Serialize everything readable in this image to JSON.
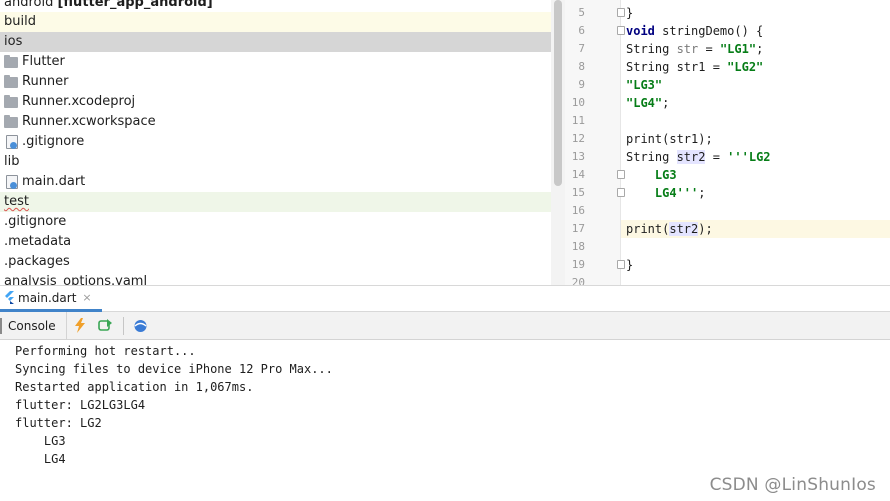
{
  "project_tree": {
    "rows": [
      {
        "indent": 4,
        "icon": "none",
        "label": "android",
        "suffix": "[flutter_app_android]",
        "highlight": "none"
      },
      {
        "indent": 4,
        "icon": "none",
        "label": "build",
        "suffix": "",
        "highlight": "yellow"
      },
      {
        "indent": 4,
        "icon": "none",
        "label": "ios",
        "suffix": "",
        "highlight": "selected"
      },
      {
        "indent": 4,
        "icon": "folder-icon",
        "label": "Flutter",
        "suffix": "",
        "highlight": "none"
      },
      {
        "indent": 4,
        "icon": "folder-icon",
        "label": "Runner",
        "suffix": "",
        "highlight": "none"
      },
      {
        "indent": 4,
        "icon": "folder-icon",
        "label": "Runner.xcodeproj",
        "suffix": "",
        "highlight": "none"
      },
      {
        "indent": 4,
        "icon": "folder-icon",
        "label": "Runner.xcworkspace",
        "suffix": "",
        "highlight": "none"
      },
      {
        "indent": 4,
        "icon": "file-icon",
        "label": ".gitignore",
        "suffix": "",
        "highlight": "none"
      },
      {
        "indent": 4,
        "icon": "none",
        "label": "lib",
        "suffix": "",
        "highlight": "none"
      },
      {
        "indent": 4,
        "icon": "file-icon",
        "label": "main.dart",
        "suffix": "",
        "highlight": "none"
      },
      {
        "indent": 4,
        "icon": "none",
        "label": "test",
        "suffix": "",
        "highlight": "green"
      },
      {
        "indent": 4,
        "icon": "none",
        "label": ".gitignore",
        "suffix": "",
        "highlight": "none"
      },
      {
        "indent": 4,
        "icon": "none",
        "label": ".metadata",
        "suffix": "",
        "highlight": "none"
      },
      {
        "indent": 4,
        "icon": "none",
        "label": ".packages",
        "suffix": "",
        "highlight": "none"
      },
      {
        "indent": 4,
        "icon": "none",
        "label": "analysis_options.yaml",
        "suffix": "",
        "highlight": "none"
      }
    ]
  },
  "editor": {
    "lines": [
      {
        "num": "5",
        "text": "}",
        "fold": true
      },
      {
        "num": "6",
        "text": "void stringDemo() {",
        "fold": true
      },
      {
        "num": "7",
        "text": "String str = \"LG1\";",
        "fold": false
      },
      {
        "num": "8",
        "text": "String str1 = \"LG2\"",
        "fold": false
      },
      {
        "num": "9",
        "text": "\"LG3\"",
        "fold": false
      },
      {
        "num": "10",
        "text": "\"LG4\";",
        "fold": false
      },
      {
        "num": "11",
        "text": "",
        "fold": false
      },
      {
        "num": "12",
        "text": "print(str1);",
        "fold": false
      },
      {
        "num": "13",
        "text": "String str2 = '''LG2",
        "fold": false
      },
      {
        "num": "14",
        "text": "    LG3",
        "fold": true
      },
      {
        "num": "15",
        "text": "    LG4''';",
        "fold": true
      },
      {
        "num": "16",
        "text": "",
        "fold": false
      },
      {
        "num": "17",
        "text": "print(str2);",
        "fold": false,
        "current": true
      },
      {
        "num": "18",
        "text": "",
        "fold": false
      },
      {
        "num": "19",
        "text": "}",
        "fold": true
      },
      {
        "num": "20",
        "text": "",
        "fold": false
      }
    ]
  },
  "file_tab": {
    "label": "main.dart",
    "close": "×"
  },
  "run_toolbar": {
    "console_label": "Console"
  },
  "console": {
    "lines": [
      "Performing hot restart...",
      "Syncing files to device iPhone 12 Pro Max...",
      "Restarted application in 1,067ms.",
      "flutter: LG2LG3LG4",
      "flutter: LG2",
      "    LG3",
      "    LG4"
    ]
  },
  "watermark": "CSDN @LinShunIos",
  "colors": {
    "keyword": "#000080",
    "string": "#067d17",
    "selection": "#dfdfdf",
    "accent": "#4083c9"
  }
}
